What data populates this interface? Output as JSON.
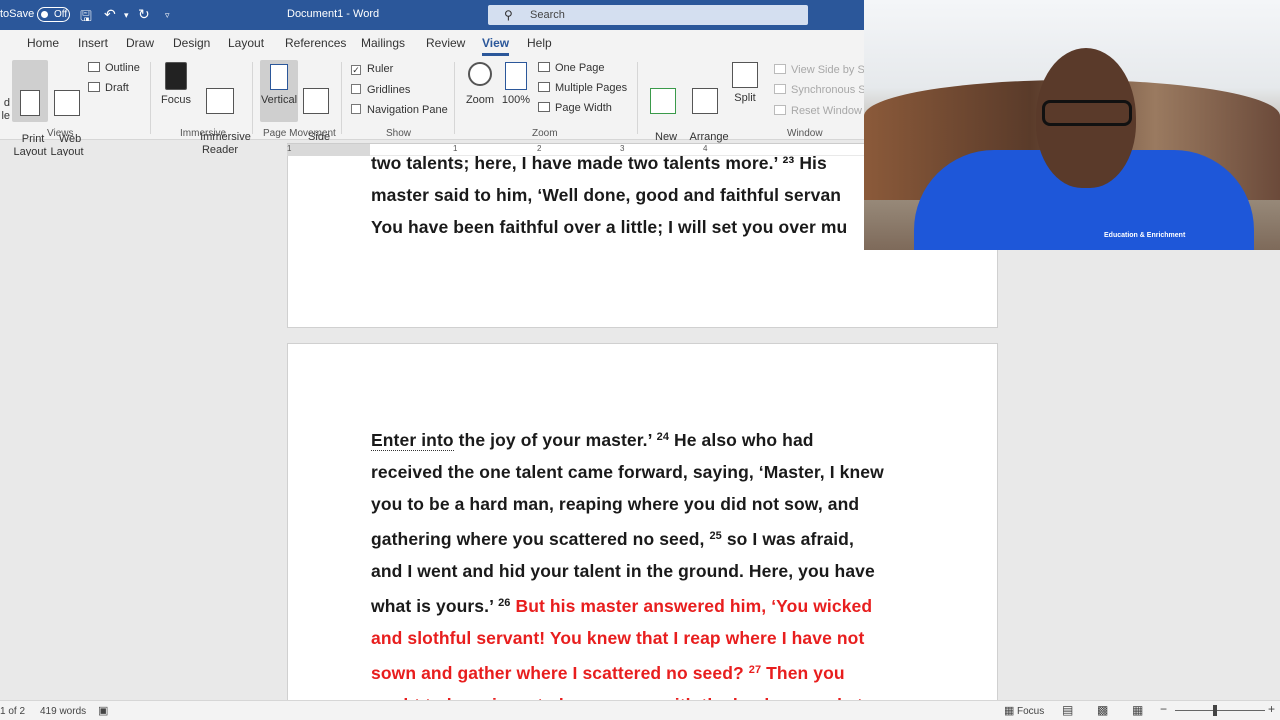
{
  "titlebar": {
    "autosave_label": "toSave",
    "autosave_state": "Off",
    "doc_title": "Document1 - Word",
    "search_placeholder": "Search"
  },
  "tabs": [
    "Home",
    "Insert",
    "Draw",
    "Design",
    "Layout",
    "References",
    "Mailings",
    "Review",
    "View",
    "Help"
  ],
  "active_tab": "View",
  "ribbon": {
    "views": {
      "read_mode_fragment": "d\nle",
      "print_layout": "Print\nLayout",
      "web_layout": "Web\nLayout",
      "outline": "Outline",
      "draft": "Draft",
      "group": "Views"
    },
    "immersive": {
      "focus": "Focus",
      "immersive_reader": "Immersive\nReader",
      "group": "Immersive"
    },
    "page_movement": {
      "vertical": "Vertical",
      "side_to_side": "Side\nto Side",
      "group": "Page Movement"
    },
    "show": {
      "ruler": "Ruler",
      "gridlines": "Gridlines",
      "navigation_pane": "Navigation Pane",
      "group": "Show"
    },
    "zoom": {
      "zoom": "Zoom",
      "hundred": "100%",
      "one_page": "One Page",
      "multiple_pages": "Multiple Pages",
      "page_width": "Page Width",
      "group": "Zoom"
    },
    "window": {
      "new_window": "New\nWindow",
      "arrange_all": "Arrange\nAll",
      "split": "Split",
      "view_side_by_side": "View Side by Si",
      "synchronous_scrolling": "Synchronous Sc",
      "reset_window_position": "Reset Window P",
      "group": "Window"
    }
  },
  "ruler_numbers": [
    "1",
    "1",
    "2",
    "3",
    "4"
  ],
  "page1_lines": [
    "two talents; here, I have made two talents more.’ ²³ His",
    "master said to him, ‘Well done, good and faithful servan",
    "You have been faithful over a little; I will set you over mu"
  ],
  "page2": {
    "l1_a": "Enter into",
    "l1_b": " the joy of your master.’ ",
    "v24": "24",
    "l1_c": " He also who had",
    "l2": "received the one talent came forward, saying, ‘Master, I knew",
    "l3": "you to be a hard man, reaping where you did not sow, and",
    "l4_a": "gathering where you scattered no seed, ",
    "v25": "25",
    "l4_b": " so I was afraid,",
    "l5": "and I went and hid your talent in the ground. Here, you have",
    "l6_a": "what is yours.’ ",
    "v26": "26",
    "l6_b": " But his master answered him, ‘You wicked",
    "l7": "and slothful servant! You knew that I reap where I have not",
    "l8_a": "sown and gather where I scattered no seed? ",
    "v27": "27",
    "l8_b": " Then you",
    "l9": "ought to have invested my money with the bankers, and at"
  },
  "status": {
    "page": "1 of 2",
    "words": "419 words",
    "focus": "Focus"
  },
  "webcam": {
    "shirt_text": "Education & Enrichment"
  },
  "colors": {
    "word_blue": "#2b579a",
    "scripture_red": "#e81e1e"
  }
}
